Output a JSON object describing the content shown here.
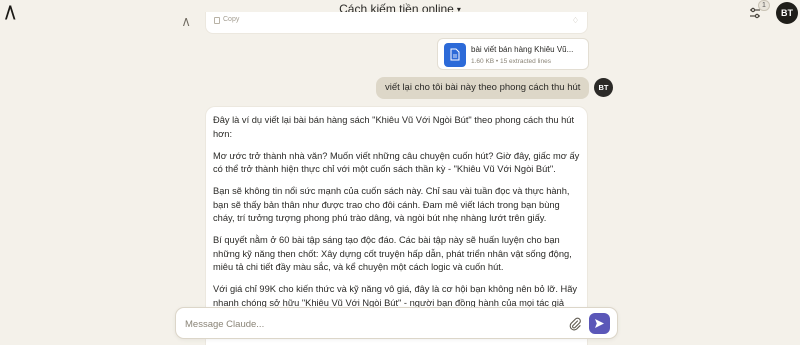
{
  "header": {
    "title": "Cách kiếm tiền online",
    "notification_count": "1",
    "user_initials": "BT"
  },
  "previous_message": {
    "copy_label": "Copy"
  },
  "attachment": {
    "file_name": "bài viết bán hàng Khiêu Vũ...",
    "file_meta": "1.60 KB • 15 extracted lines"
  },
  "user_message": {
    "text": "viết lại cho tôi bài này theo phong cách thu hút",
    "initials": "BT"
  },
  "response": {
    "paragraphs": [
      "Đây là ví dụ viết lại bài bán hàng sách \"Khiêu Vũ Với Ngòi Bút\" theo phong cách thu hút hơn:",
      "Mơ ước trở thành nhà văn? Muốn viết những câu chuyện cuốn hút? Giờ đây, giấc mơ ấy có thể trở thành hiện thực chỉ với một cuốn sách thần kỳ - \"Khiêu Vũ Với Ngòi Bút\".",
      "Bạn sẽ không tin nổi sức mạnh của cuốn sách này. Chỉ sau vài tuần đọc và thực hành, bạn sẽ thấy bản thân như được trao cho đôi cánh. Đam mê viết lách trong bạn bùng cháy, trí tưởng tượng phong phú trào dâng, và ngòi bút nhẹ nhàng lướt trên giấy.",
      "Bí quyết nằm ở 60 bài tập sáng tạo độc đáo. Các bài tập này sẽ huấn luyện cho bạn những kỹ năng then chốt: Xây dựng cốt truyện hấp dẫn, phát triển nhân vật sống động, miêu tả chi tiết đầy màu sắc, và kể chuyện một cách logic và cuốn hút.",
      "Với giá chỉ 99K cho kiến thức và kỹ năng vô giá, đây là cơ hội bạn không nên bỏ lỡ. Hãy nhanh chóng sở hữu \"Khiêu Vũ Với Ngòi Bút\" - người bạn đồng hành của mọi tác giả"
    ]
  },
  "composer": {
    "placeholder": "Message Claude..."
  },
  "colors": {
    "background": "#f4f1ea",
    "user_bubble": "#ddd7c8",
    "send_button": "#5b57b8",
    "file_icon": "#2c6ad8"
  }
}
